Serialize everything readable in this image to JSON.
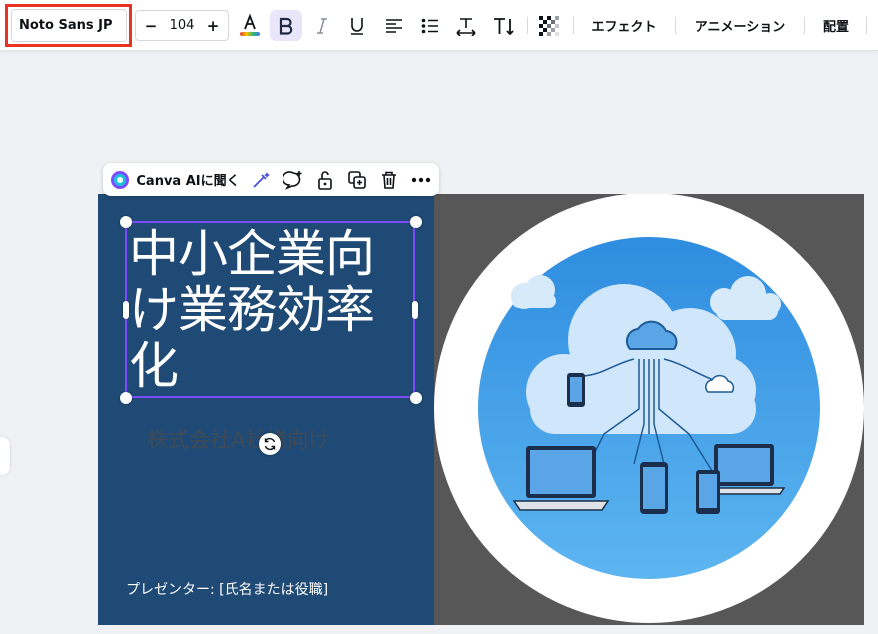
{
  "toolbar": {
    "font_family": "Noto Sans JP",
    "font_size": "104",
    "minus": "−",
    "plus": "+",
    "effects": "エフェクト",
    "animation": "アニメーション",
    "position": "配置",
    "text_color_accent": "#e23b3b",
    "highlight_color": "#ea3323"
  },
  "context_toolbar": {
    "ask_ai_label": "Canva AIに聞く"
  },
  "slide": {
    "title_line1": "中小企業向",
    "title_line2": "け業務効率",
    "title_line3": "化",
    "subtitle": "株式会社A社様向け",
    "presenter": "プレゼンター: [氏名または役職]",
    "left_bg": "#1f4a75",
    "right_bg": "#575757",
    "selection_color": "#7c4dff"
  }
}
